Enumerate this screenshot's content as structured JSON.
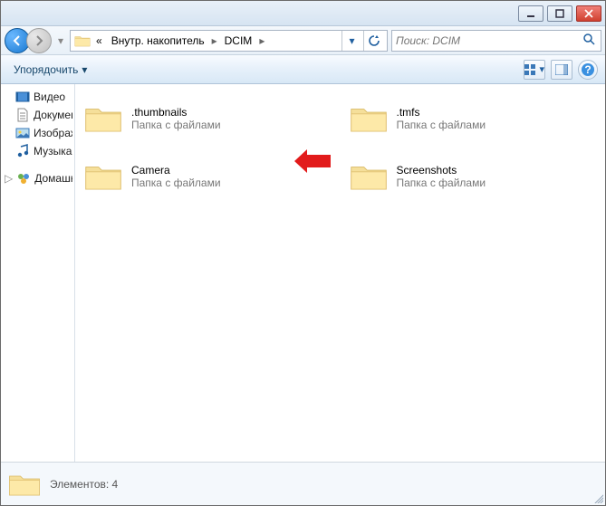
{
  "titlebar": {
    "min_tip": "Свернуть",
    "max_tip": "Развернуть",
    "close_tip": "Закрыть"
  },
  "nav": {
    "back_tip": "Назад",
    "forward_tip": "Вперёд"
  },
  "breadcrumbs": {
    "root_sep": "«",
    "segment1": "Внутр. накопитель",
    "segment2": "DCIM"
  },
  "search": {
    "placeholder": "Поиск: DCIM"
  },
  "toolbar": {
    "organize_label": "Упорядочить",
    "view_tip": "Изменить представление",
    "preview_tip": "Показать область предварительного просмотра",
    "help_tip": "Справка"
  },
  "sidebar": {
    "items": [
      {
        "icon": "video-icon",
        "label": "Видео"
      },
      {
        "icon": "document-icon",
        "label": "Документы"
      },
      {
        "icon": "image-icon",
        "label": "Изображения"
      },
      {
        "icon": "music-icon",
        "label": "Музыка"
      }
    ],
    "group": {
      "icon": "homegroup-icon",
      "label": "Домашняя группа"
    }
  },
  "folders": [
    {
      "name": ".thumbnails",
      "sub": "Папка с файлами"
    },
    {
      "name": ".tmfs",
      "sub": "Папка с файлами"
    },
    {
      "name": "Camera",
      "sub": "Папка с файлами"
    },
    {
      "name": "Screenshots",
      "sub": "Папка с файлами"
    }
  ],
  "status": {
    "text": "Элементов: 4"
  },
  "callout": {
    "target": "Camera"
  }
}
